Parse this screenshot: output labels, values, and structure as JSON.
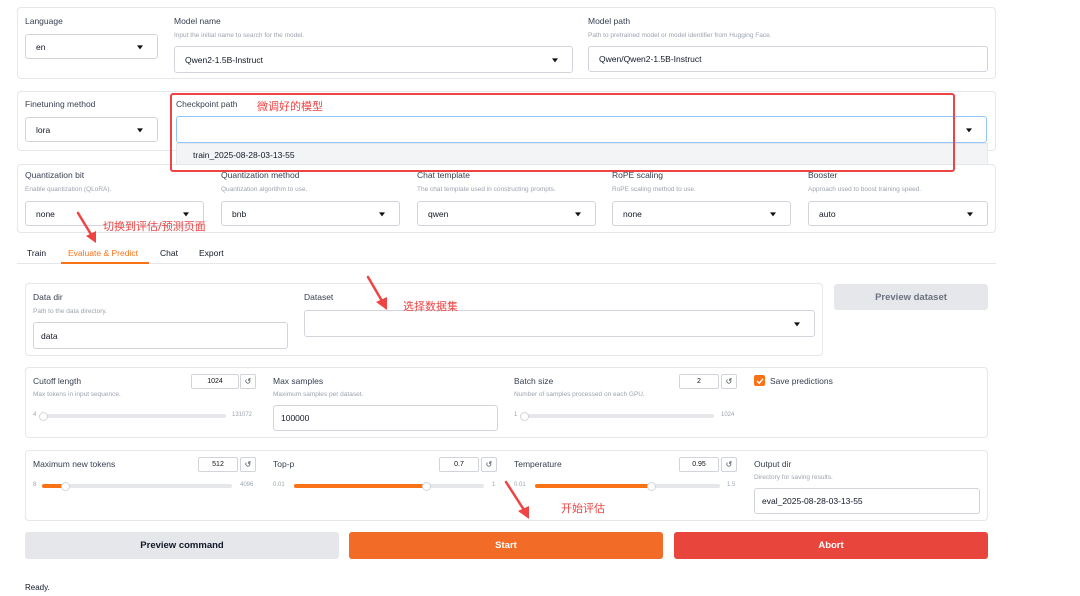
{
  "top": {
    "language": {
      "label": "Language",
      "value": "en"
    },
    "model_name": {
      "label": "Model name",
      "info": "Input the initial name to search for the model.",
      "value": "Qwen2-1.5B-Instruct"
    },
    "model_path": {
      "label": "Model path",
      "info": "Path to pretrained model or model identifier from Hugging Face.",
      "value": "Qwen/Qwen2-1.5B-Instruct"
    }
  },
  "adapter": {
    "finetuning_method": {
      "label": "Finetuning method",
      "value": "lora"
    },
    "checkpoint_path": {
      "label": "Checkpoint path",
      "value": "",
      "option": "train_2025-08-28-03-13-55"
    }
  },
  "advanced": {
    "quantization_bit": {
      "label": "Quantization bit",
      "info": "Enable quantization (QLoRA).",
      "value": "none"
    },
    "quantization_method": {
      "label": "Quantization method",
      "info": "Quantization algorithm to use.",
      "value": "bnb"
    },
    "chat_template": {
      "label": "Chat template",
      "info": "The chat template used in constructing prompts.",
      "value": "qwen"
    },
    "rope_scaling": {
      "label": "RoPE scaling",
      "info": "RoPE scaling method to use.",
      "value": "none"
    },
    "booster": {
      "label": "Booster",
      "info": "Approach used to boost training speed.",
      "value": "auto"
    }
  },
  "tabs": [
    "Train",
    "Evaluate & Predict",
    "Chat",
    "Export"
  ],
  "active_tab": "Evaluate & Predict",
  "dataset": {
    "data_dir": {
      "label": "Data dir",
      "info": "Path to the data directory.",
      "value": "data"
    },
    "dataset": {
      "label": "Dataset",
      "value": ""
    },
    "preview_label": "Preview dataset"
  },
  "params1": {
    "cutoff_length": {
      "label": "Cutoff length",
      "info": "Max tokens in input sequence.",
      "value": "1024",
      "min": "4",
      "max": "131072",
      "fraction": 0.008
    },
    "max_samples": {
      "label": "Max samples",
      "info": "Maximum samples per dataset.",
      "value": "100000"
    },
    "batch_size": {
      "label": "Batch size",
      "info": "Number of samples processed on each GPU.",
      "value": "2",
      "min": "1",
      "max": "1024",
      "fraction": 0.001
    },
    "save_predictions": {
      "label": "Save predictions",
      "checked": true
    }
  },
  "params2": {
    "max_new_tokens": {
      "label": "Maximum new tokens",
      "value": "512",
      "min": "8",
      "max": "4096",
      "fraction": 0.123
    },
    "top_p": {
      "label": "Top-p",
      "value": "0.7",
      "min": "0.01",
      "max": "1",
      "fraction": 0.697
    },
    "temperature": {
      "label": "Temperature",
      "value": "0.95",
      "min": "0.01",
      "max": "1.5",
      "fraction": 0.631
    },
    "output_dir": {
      "label": "Output dir",
      "info": "Directory for saving results.",
      "value": "eval_2025-08-28-03-13-55"
    }
  },
  "actions": {
    "preview_command": "Preview command",
    "start": "Start",
    "abort": "Abort"
  },
  "status": "Ready.",
  "icons": {
    "reset": "↺"
  },
  "annotations": {
    "checkpoint_note": "微调好的模型",
    "tab_note": "切换到评估/预测页面",
    "dataset_note": "选择数据集",
    "start_note": "开始评估"
  },
  "colors": {
    "accent": "#f97316",
    "abort": "#ef4444",
    "annotation": "#ef4444"
  }
}
